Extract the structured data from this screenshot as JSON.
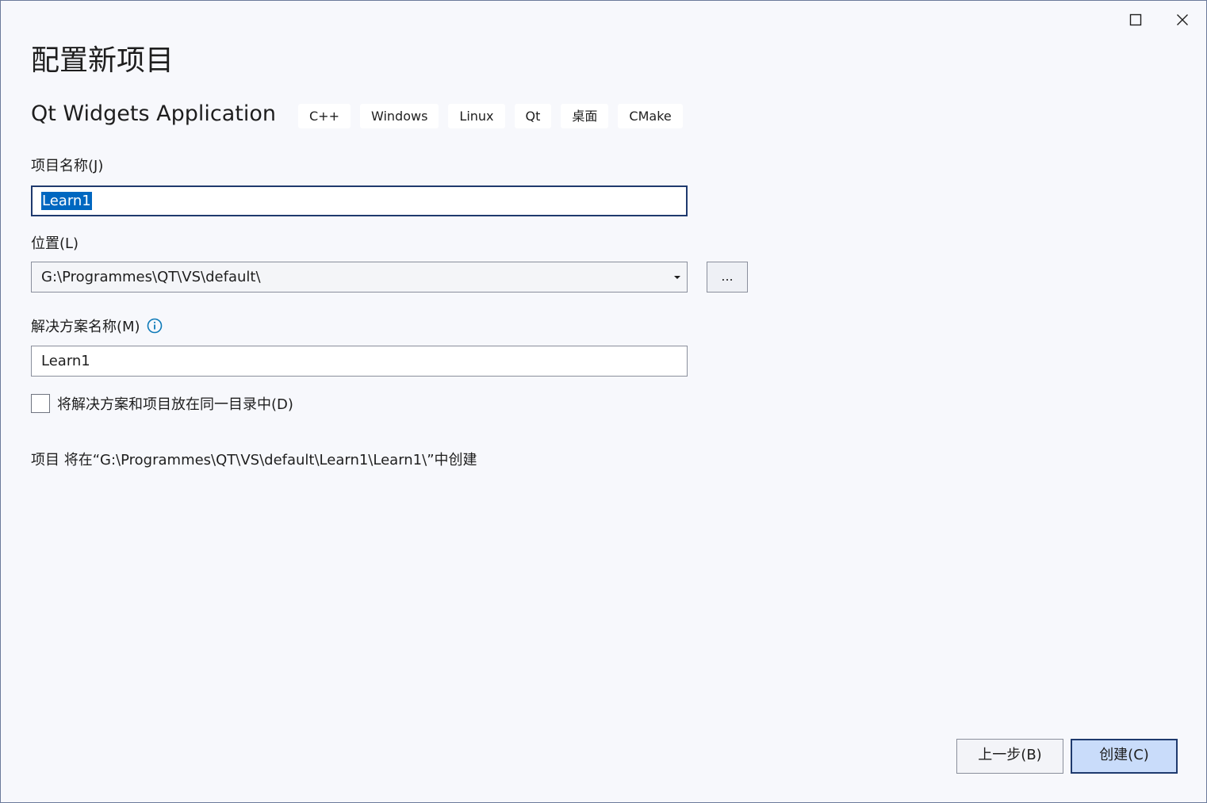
{
  "window": {
    "maximize_icon": "maximize-icon",
    "close_icon": "close-icon"
  },
  "page": {
    "title": "配置新项目"
  },
  "template": {
    "name": "Qt Widgets Application",
    "tags": [
      "C++",
      "Windows",
      "Linux",
      "Qt",
      "桌面",
      "CMake"
    ]
  },
  "project_name": {
    "label": "项目名称(J)",
    "value": "Learn1"
  },
  "location": {
    "label": "位置(L)",
    "value": "G:\\Programmes\\QT\\VS\\default\\",
    "browse_label": "..."
  },
  "solution_name": {
    "label": "解决方案名称(M)",
    "value": "Learn1",
    "info_icon": "info-icon"
  },
  "same_dir_checkbox": {
    "label": "将解决方案和项目放在同一目录中(D)",
    "checked": false
  },
  "creation_info": "项目 将在“G:\\Programmes\\QT\\VS\\default\\Learn1\\Learn1\\”中创建",
  "footer": {
    "back_label": "上一步(B)",
    "create_label": "创建(C)"
  },
  "colors": {
    "accent": "#0067c0",
    "primary_button_bg": "#c9dcfa",
    "focus_border": "#1f3a6e",
    "info_icon": "#0e7ab8"
  }
}
